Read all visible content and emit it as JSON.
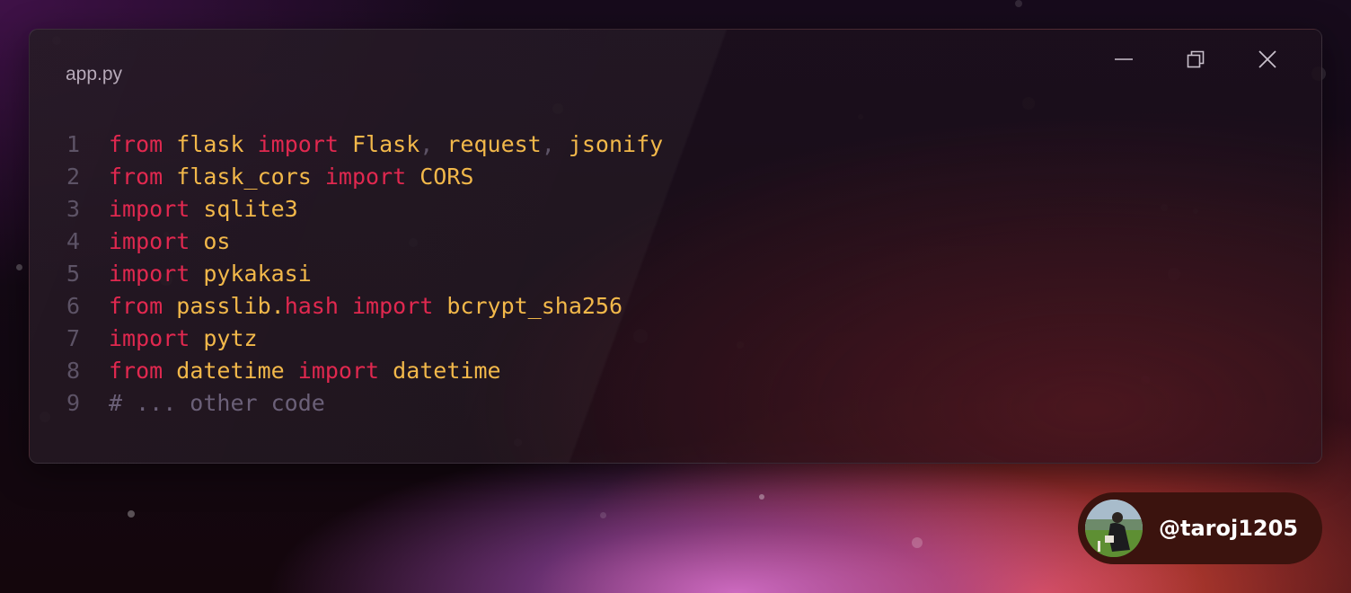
{
  "window": {
    "title": "app.py",
    "controls": {
      "minimize_icon": "minimize-icon",
      "restore_icon": "restore-icon",
      "close_icon": "close-icon"
    }
  },
  "code": {
    "lines": [
      {
        "number": "1",
        "tokens": [
          {
            "t": "from",
            "c": "kw"
          },
          {
            "t": " ",
            "c": "id"
          },
          {
            "t": "flask",
            "c": "id"
          },
          {
            "t": " ",
            "c": "id"
          },
          {
            "t": "import",
            "c": "kw"
          },
          {
            "t": " ",
            "c": "id"
          },
          {
            "t": "Flask",
            "c": "id"
          },
          {
            "t": ", ",
            "c": "pn"
          },
          {
            "t": "request",
            "c": "id"
          },
          {
            "t": ", ",
            "c": "pn"
          },
          {
            "t": "jsonify",
            "c": "id"
          }
        ]
      },
      {
        "number": "2",
        "tokens": [
          {
            "t": "from",
            "c": "kw"
          },
          {
            "t": " ",
            "c": "id"
          },
          {
            "t": "flask_cors",
            "c": "id"
          },
          {
            "t": " ",
            "c": "id"
          },
          {
            "t": "import",
            "c": "kw"
          },
          {
            "t": " ",
            "c": "id"
          },
          {
            "t": "CORS",
            "c": "id"
          }
        ]
      },
      {
        "number": "3",
        "tokens": [
          {
            "t": "import",
            "c": "kw"
          },
          {
            "t": " ",
            "c": "id"
          },
          {
            "t": "sqlite3",
            "c": "id"
          }
        ]
      },
      {
        "number": "4",
        "tokens": [
          {
            "t": "import",
            "c": "kw"
          },
          {
            "t": " ",
            "c": "id"
          },
          {
            "t": "os",
            "c": "id"
          }
        ]
      },
      {
        "number": "5",
        "tokens": [
          {
            "t": "import",
            "c": "kw"
          },
          {
            "t": " ",
            "c": "id"
          },
          {
            "t": "pykakasi",
            "c": "id"
          }
        ]
      },
      {
        "number": "6",
        "tokens": [
          {
            "t": "from",
            "c": "kw"
          },
          {
            "t": " ",
            "c": "id"
          },
          {
            "t": "passlib.",
            "c": "id"
          },
          {
            "t": "hash",
            "c": "kw"
          },
          {
            "t": " ",
            "c": "id"
          },
          {
            "t": "import",
            "c": "kw"
          },
          {
            "t": " ",
            "c": "id"
          },
          {
            "t": "bcrypt_sha256",
            "c": "id"
          }
        ]
      },
      {
        "number": "7",
        "tokens": [
          {
            "t": "import",
            "c": "kw"
          },
          {
            "t": " ",
            "c": "id"
          },
          {
            "t": "pytz",
            "c": "id"
          }
        ]
      },
      {
        "number": "8",
        "tokens": [
          {
            "t": "from",
            "c": "kw"
          },
          {
            "t": " ",
            "c": "id"
          },
          {
            "t": "datetime",
            "c": "id"
          },
          {
            "t": " ",
            "c": "id"
          },
          {
            "t": "import",
            "c": "kw"
          },
          {
            "t": " ",
            "c": "id"
          },
          {
            "t": "datetime",
            "c": "id"
          }
        ]
      },
      {
        "number": "9",
        "tokens": [
          {
            "t": "# ... other code",
            "c": "cm"
          }
        ]
      }
    ]
  },
  "author": {
    "handle": "@taroj1205",
    "avatar_icon": "avatar"
  },
  "colors": {
    "keyword": "#e0284f",
    "identifier": "#f2b84a",
    "comment": "#6b6078",
    "line_number": "#5d5366",
    "badge_bg": "#3b130e"
  }
}
